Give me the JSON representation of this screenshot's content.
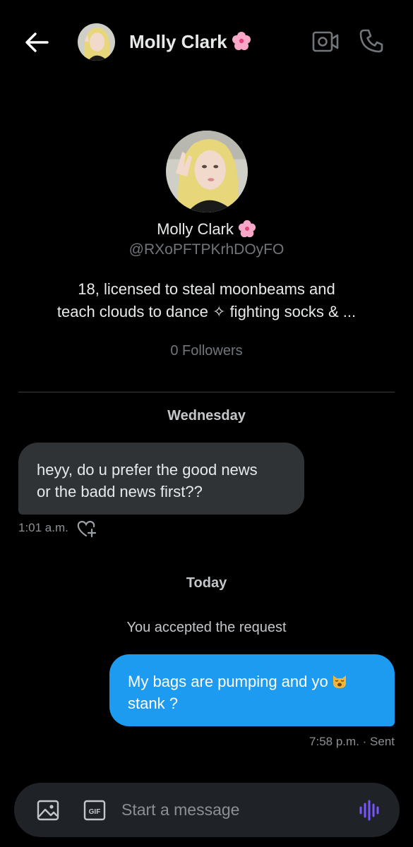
{
  "header": {
    "name": "Molly Clark",
    "back_icon": "arrow-left-icon",
    "video_icon": "video-call-icon",
    "call_icon": "phone-icon"
  },
  "profile": {
    "name": "Molly Clark",
    "handle": "@RXoPFTPKrhDOyFO",
    "bio_line1": "18, licensed to steal moonbeams and",
    "bio_line2": "teach clouds to dance ✧ fighting socks & ...",
    "followers": "0 Followers"
  },
  "conversation": {
    "day1": "Wednesday",
    "incoming": {
      "line1": "heyy, do u prefer the good news",
      "line2": "or the badd news first??",
      "time": "1:01 a.m."
    },
    "day2": "Today",
    "system": "You accepted the request",
    "outgoing": {
      "line1": "My bags are pumping and yo",
      "line2": "stank ?",
      "meta": "7:58 p.m. · Sent"
    }
  },
  "composer": {
    "placeholder": "Start a message",
    "gif_label": "GIF"
  },
  "colors": {
    "background": "#000000",
    "incoming_bubble": "#2f3336",
    "outgoing_bubble": "#1d9bf0",
    "voice_accent": "#7856ff"
  }
}
